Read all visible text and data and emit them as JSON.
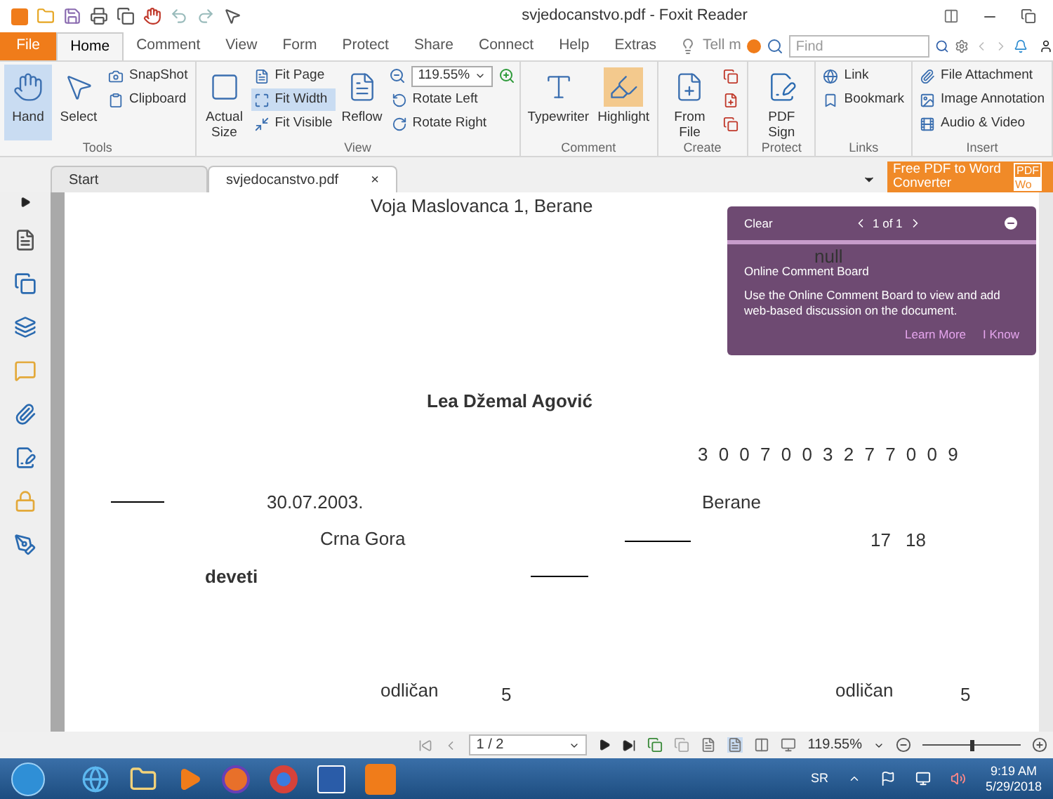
{
  "window": {
    "title": "svjedocanstvo.pdf - Foxit Reader"
  },
  "menu_tabs": [
    {
      "label": "File",
      "selected": false,
      "kind": "file"
    },
    {
      "label": "Home",
      "selected": true,
      "kind": "tab"
    },
    {
      "label": "Comment",
      "selected": false,
      "kind": "tab"
    },
    {
      "label": "View",
      "selected": false,
      "kind": "tab"
    },
    {
      "label": "Form",
      "selected": false,
      "kind": "tab"
    },
    {
      "label": "Protect",
      "selected": false,
      "kind": "tab"
    },
    {
      "label": "Share",
      "selected": false,
      "kind": "tab"
    },
    {
      "label": "Connect",
      "selected": false,
      "kind": "tab"
    },
    {
      "label": "Help",
      "selected": false,
      "kind": "tab"
    },
    {
      "label": "Extras",
      "selected": false,
      "kind": "tab"
    }
  ],
  "tell_me": "Tell m",
  "search": {
    "placeholder": "Find"
  },
  "ribbon_groups": [
    {
      "label": "Tools",
      "columns": [
        [
          {
            "kind": "large",
            "label": "Hand",
            "selected": true
          }
        ],
        [
          {
            "kind": "large",
            "label": "Select",
            "selected": false
          }
        ],
        [
          {
            "kind": "small",
            "label": "SnapShot",
            "selected": false
          },
          {
            "kind": "small",
            "label": "Clipboard",
            "selected": false
          }
        ]
      ]
    },
    {
      "label": "View",
      "columns": [
        [
          {
            "kind": "large",
            "label": "Actual Size",
            "selected": false
          }
        ],
        [
          {
            "kind": "small",
            "label": "Fit Page",
            "selected": false
          },
          {
            "kind": "small",
            "label": "Fit Width",
            "selected": true
          },
          {
            "kind": "small",
            "label": "Fit Visible",
            "selected": false
          }
        ],
        [
          {
            "kind": "large",
            "label": "Reflow",
            "selected": false
          }
        ],
        [
          {
            "kind": "combo",
            "label": "119.55%"
          },
          {
            "kind": "small",
            "label": "Rotate Left",
            "selected": false
          },
          {
            "kind": "small",
            "label": "Rotate Right",
            "selected": false
          }
        ]
      ]
    },
    {
      "label": "Comment",
      "columns": [
        [
          {
            "kind": "large",
            "label": "Typewriter",
            "selected": false
          }
        ],
        [
          {
            "kind": "large",
            "label": "Highlight",
            "selected": false
          }
        ]
      ]
    },
    {
      "label": "Create",
      "columns": [
        [
          {
            "kind": "large",
            "label": "From File",
            "selected": false
          }
        ],
        [
          {
            "kind": "icon",
            "selected": false
          },
          {
            "kind": "icon",
            "selected": false
          },
          {
            "kind": "icon",
            "selected": false
          }
        ]
      ]
    },
    {
      "label": "Protect",
      "columns": [
        [
          {
            "kind": "large",
            "label": "PDF Sign",
            "selected": false
          }
        ]
      ]
    },
    {
      "label": "Links",
      "columns": [
        [
          {
            "kind": "small",
            "label": "Link",
            "selected": false
          },
          {
            "kind": "small",
            "label": "Bookmark",
            "selected": false
          }
        ]
      ]
    },
    {
      "label": "Insert",
      "columns": [
        [
          {
            "kind": "small",
            "label": "File Attachment",
            "selected": false
          },
          {
            "kind": "small",
            "label": "Image Annotation",
            "selected": false
          },
          {
            "kind": "small",
            "label": "Audio & Video",
            "selected": false
          }
        ]
      ]
    }
  ],
  "doc_tabs": [
    {
      "label": "Start",
      "selected": false
    },
    {
      "label": "svjedocanstvo.pdf",
      "selected": true,
      "close": "×"
    }
  ],
  "promo": {
    "text": "Free PDF to Word Converter",
    "badge_1": "PDF",
    "badge_2": "Wo"
  },
  "page_texts": [
    {
      "text": "Voja Maslovanca 1, Berane",
      "bold": false
    },
    {
      "text": "null",
      "bold": false
    },
    {
      "text": "Lea Džemal Agović",
      "bold": true
    },
    {
      "text": "3 0 0 7 0 0 3 2 7 7 0 0 9",
      "bold": false
    },
    {
      "text": "30.07.2003.",
      "bold": false
    },
    {
      "text": "Berane",
      "bold": false
    },
    {
      "text": "Crna Gora",
      "bold": false
    },
    {
      "text": "17",
      "bold": false
    },
    {
      "text": "18",
      "bold": false
    },
    {
      "text": "deveti",
      "bold": true
    },
    {
      "text": "odličan",
      "bold": false
    },
    {
      "text": "5",
      "bold": false
    },
    {
      "text": "odličan",
      "bold": false
    },
    {
      "text": "5",
      "bold": false
    }
  ],
  "comment_board": {
    "clear": "Clear",
    "pager": "1 of 1",
    "title": "Online Comment Board",
    "body": "Use the Online Comment Board to view and add web-based discussion on the document.",
    "learn_more": "Learn More",
    "i_know": "I Know"
  },
  "status_bar": {
    "page": "1 / 2",
    "zoom": "119.55%",
    "zoom_slider": {
      "level": 0.5
    }
  },
  "taskbar": {
    "language": "SR",
    "time": "9:19 AM",
    "date": "5/29/2018"
  }
}
